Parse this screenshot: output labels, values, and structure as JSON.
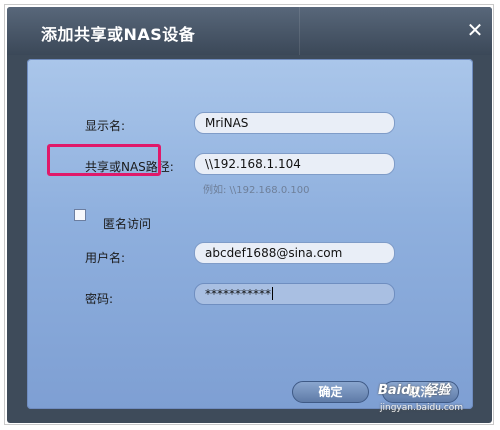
{
  "dialog": {
    "title": "添加共享或NAS设备",
    "close_glyph": "✕"
  },
  "form": {
    "display_name_label": "显示名:",
    "display_name_value": "MriNAS",
    "share_path_label": "共享或NAS路径:",
    "share_path_value": "\\\\192.168.1.104",
    "share_path_hint": "例如: \\\\192.168.0.100",
    "anonymous_label": "匿名访问",
    "anonymous_checked": false,
    "username_label": "用户名:",
    "username_value": "abcdef1688@sina.com",
    "password_label": "密码:",
    "password_value": "***********"
  },
  "buttons": {
    "ok_label": "确定",
    "cancel_label": "取消"
  },
  "watermark": {
    "logo_text": "Baidu 经验",
    "site": "jingyan.baidu.com"
  },
  "colors": {
    "titlebar": "#4a5869",
    "panel_top": "#aac6ea",
    "panel_bottom": "#7e9fd3",
    "highlight": "#e0196a"
  }
}
